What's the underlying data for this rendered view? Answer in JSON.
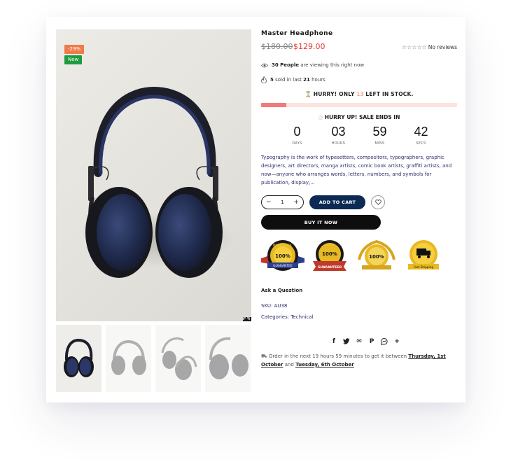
{
  "badges": {
    "sale": "-29%",
    "new": "New"
  },
  "product": {
    "title": "Master Headphone",
    "old_price": "$180.00",
    "price": "$129.00",
    "rating_stars": "☆☆☆☆☆",
    "rating_text": "No reviews"
  },
  "viewing": {
    "count": "30 People",
    "text": "are viewing this right now"
  },
  "sold": {
    "count": "5",
    "text_mid": "sold in last",
    "hours": "21",
    "text_end": "hours"
  },
  "stock": {
    "prefix": "HURRY! ONLY",
    "count": "13",
    "suffix": "LEFT IN STOCK.",
    "fill_percent": 13
  },
  "sale": {
    "title": "HURRY UP! SALE ENDS IN",
    "countdown": [
      {
        "value": "0",
        "label": "DAYS"
      },
      {
        "value": "03",
        "label": "HOURS"
      },
      {
        "value": "59",
        "label": "MINS"
      },
      {
        "value": "42",
        "label": "SECS"
      }
    ]
  },
  "description": "Typography is the work of typesetters, compositors, typographers, graphic designers, art directors, manga artists, comic book artists, graffiti artists, and now—anyone who arranges words, letters, numbers, and symbols for publication, display,...",
  "cart": {
    "minus": "−",
    "quantity": "1",
    "plus": "+",
    "add_to_cart": "ADD TO CART",
    "buy_now": "BUY IT NOW"
  },
  "trust_badges": [
    {
      "top": "MONEY BACK",
      "center": "100%",
      "ribbon": "GUARANTEE"
    },
    {
      "top": "SECURE",
      "center": "100%",
      "ribbon": "GUARANTEED"
    },
    {
      "top": "",
      "center": "100%",
      "ribbon": ""
    },
    {
      "top": "",
      "center": "",
      "ribbon": "Fast Shipping"
    }
  ],
  "ask_question": "Ask a Question",
  "sku": {
    "label": "SKU:",
    "value": "AU38"
  },
  "categories": {
    "label": "Categories:",
    "value": "Technical"
  },
  "social": [
    {
      "icon": "facebook-icon",
      "glyph": "f"
    },
    {
      "icon": "twitter-icon",
      "glyph": "🐦"
    },
    {
      "icon": "email-icon",
      "glyph": "✉"
    },
    {
      "icon": "pinterest-icon",
      "glyph": "P"
    },
    {
      "icon": "messenger-icon",
      "glyph": "◉"
    },
    {
      "icon": "plus-icon",
      "glyph": "+"
    }
  ],
  "delivery": {
    "text1": "Order in the next 19 hours 59 minutes to get it between",
    "date1": "Thursday, 1st October",
    "and": "and",
    "date2": "Tuesday, 6th October"
  },
  "colors": {
    "accent_red": "#e03c31",
    "navy": "#0c2a54",
    "sale_badge": "#f07a4a",
    "new_badge": "#1f9b3f",
    "stock_bar": "#f27b7b"
  }
}
